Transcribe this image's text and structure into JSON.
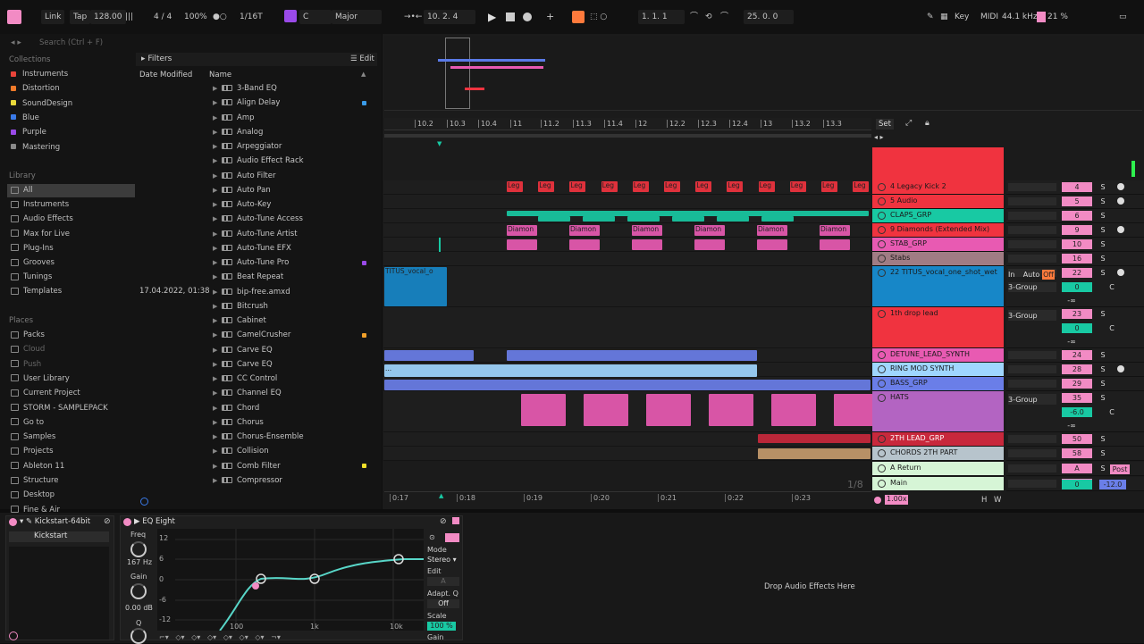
{
  "transport": {
    "link": "Link",
    "tap": "Tap",
    "tempo": "128.00",
    "signature": "4 / 4",
    "zoom": "100%",
    "quantize": "1/16T",
    "key": "C",
    "scale": "Major",
    "position": "10.  2.  4",
    "loop_start": "1.  1.  1",
    "loop_length": "25.  0.  0",
    "key_btn": "Key",
    "midi_btn": "MIDI",
    "sample_rate": "44.1 kHz",
    "cpu": "21 %"
  },
  "browser": {
    "search_placeholder": "Search (Ctrl + F)",
    "collections_title": "Collections",
    "collections": [
      {
        "label": "Instruments",
        "color": "#e8443a"
      },
      {
        "label": "Distortion",
        "color": "#f07a2a"
      },
      {
        "label": "SoundDesign",
        "color": "#e8d83a"
      },
      {
        "label": "Blue",
        "color": "#3a7ae8"
      },
      {
        "label": "Purple",
        "color": "#9a4ae8"
      },
      {
        "label": "Mastering",
        "color": "#8a8a8a"
      }
    ],
    "library_title": "Library",
    "library": [
      "All",
      "Instruments",
      "Audio Effects",
      "Max for Live",
      "Plug-Ins",
      "Grooves",
      "Tunings",
      "Templates"
    ],
    "places_title": "Places",
    "places": [
      "Packs",
      "Cloud",
      "Push",
      "User Library",
      "Current Project",
      "STORM - SAMPLEPACK",
      "Go to",
      "Samples",
      "Projects",
      "Ableton 11",
      "Structure",
      "Desktop",
      "Fine & Air"
    ],
    "filters": "Filters",
    "edit": "Edit",
    "col_date": "Date Modified",
    "col_name": "Name",
    "date_value": "17.04.2022, 01:38",
    "items": [
      "3-Band EQ",
      "Align Delay",
      "Amp",
      "Analog",
      "Arpeggiator",
      "Audio Effect Rack",
      "Auto Filter",
      "Auto Pan",
      "Auto-Key",
      "Auto-Tune Access",
      "Auto-Tune Artist",
      "Auto-Tune EFX",
      "Auto-Tune Pro",
      "Beat Repeat",
      "bip-free.amxd",
      "Bitcrush",
      "Cabinet",
      "CamelCrusher",
      "Carve EQ",
      "Carve EQ",
      "CC Control",
      "Channel EQ",
      "Chord",
      "Chorus",
      "Chorus-Ensemble",
      "Collision",
      "Comb Filter",
      "Compressor"
    ]
  },
  "arrangement": {
    "bar_labels": [
      "10.2",
      "10.3",
      "10.4",
      "11",
      "11.2",
      "11.3",
      "11.4",
      "12",
      "12.2",
      "12.3",
      "12.4",
      "13",
      "13.2",
      "13.3"
    ],
    "time_labels": [
      "0:17",
      "0:18",
      "0:19",
      "0:20",
      "0:21",
      "0:22",
      "0:23"
    ],
    "set_btn": "Set",
    "page_counter": "1/8",
    "zoom_value": "1.00x",
    "clip_legacy": "Leg",
    "clip_diamond": "Diamon",
    "clip_diamond_alt": "Diamon",
    "clip_titus": "TITUS_vocal_o",
    "clip_dots": "..."
  },
  "tracks": [
    {
      "name": "4 Legacy Kick 2",
      "color": "#f0333f",
      "vol": "4"
    },
    {
      "name": "5 Audio",
      "color": "#f0333f",
      "vol": "5"
    },
    {
      "name": "CLAPS_GRP",
      "color": "#18c9a3",
      "vol": "6"
    },
    {
      "name": "9 Diamonds (Extended Mix)",
      "color": "#f0333f",
      "vol": "9"
    },
    {
      "name": "STAB_GRP",
      "color": "#e85ab2",
      "vol": "10"
    },
    {
      "name": "Stabs",
      "color": "#a07c84",
      "vol": "16"
    },
    {
      "name": "22 TITUS_vocal_one_shot_wet",
      "color": "#1787c8",
      "vol": "22"
    },
    {
      "name": "1th drop lead",
      "color": "#f0333f",
      "vol": "23"
    },
    {
      "name": "DETUNE_LEAD_SYNTH",
      "color": "#e85ab2",
      "vol": "24"
    },
    {
      "name": "RING MOD SYNTH",
      "color": "#9fd6ff",
      "vol": "28"
    },
    {
      "name": "BASS_GRP",
      "color": "#6a7ee8",
      "vol": "29"
    },
    {
      "name": "HATS",
      "color": "#b364c2",
      "vol": "35"
    },
    {
      "name": "2TH LEAD_GRP",
      "color": "#c8283c",
      "vol": "50"
    },
    {
      "name": "CHORDS 2TH PART",
      "color": "#b7c4cc",
      "vol": "58"
    },
    {
      "name": "A Return",
      "color": "#d6f5d6",
      "vol": "A"
    },
    {
      "name": "Main",
      "color": "#d6f5d6",
      "vol": "1/2"
    }
  ],
  "mixer": {
    "s": "S",
    "in": "In",
    "auto": "Auto",
    "off": "Off",
    "group": "3-Group",
    "zero": "0",
    "c": "C",
    "minf": "-∞",
    "hats_vol": "-6.0",
    "main_vol": "-12.0",
    "post": "Post",
    "h": "H",
    "w": "W"
  },
  "devices": {
    "rack_title": "Kickstart-64bit",
    "rack_sub": "Kickstart",
    "eq_title": "EQ Eight",
    "freq_label": "Freq",
    "freq_value": "167 Hz",
    "gain_label": "Gain",
    "gain_value": "0.00 dB",
    "q_label": "Q",
    "y_labels": [
      "12",
      "6",
      "0",
      "-6",
      "-12"
    ],
    "x_labels": [
      "100",
      "1k",
      "10k"
    ],
    "mode_label": "Mode",
    "mode_value": "Stereo",
    "edit_label": "Edit",
    "edit_value": "A",
    "adapt_label": "Adapt. Q",
    "adapt_value": "Off",
    "scale_label": "Scale",
    "scale_value": "100 %",
    "gain2_label": "Gain",
    "drop_text": "Drop Audio Effects Here"
  },
  "colors": {
    "accent": "#f28bc4",
    "orange": "#ff7a3c",
    "teal": "#18c9a3",
    "red": "#f0333f"
  }
}
